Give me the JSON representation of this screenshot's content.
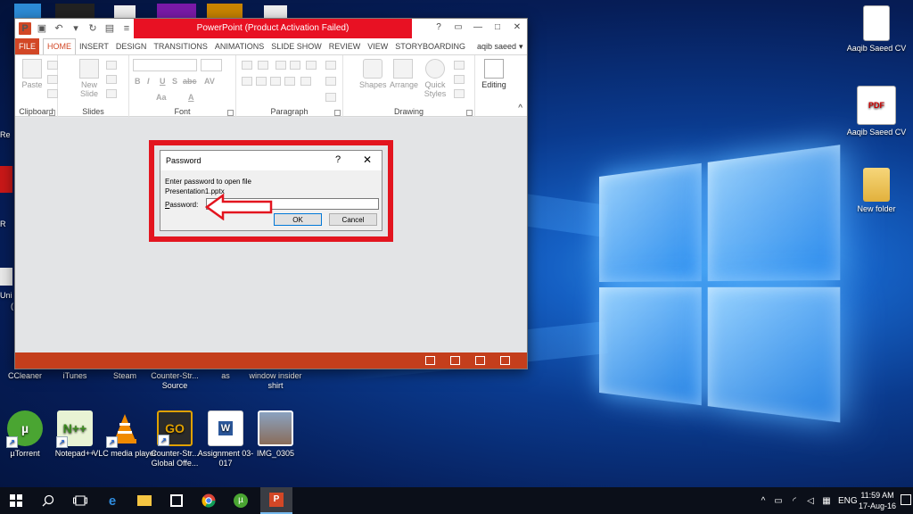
{
  "desktop": {
    "bottom_icons": [
      {
        "label": "µTorrent",
        "icon": "utorrent-icon",
        "color": "#4aa532"
      },
      {
        "label": "Notepad++",
        "icon": "notepadpp-icon",
        "color": "#7cbf3a"
      },
      {
        "label": "VLC media player",
        "icon": "vlc-icon",
        "color": "#f08a00"
      },
      {
        "label": "Counter-Str... Global Offe...",
        "icon": "csgo-icon",
        "color": "#e0a100"
      },
      {
        "label": "Assignment 03-017",
        "icon": "word-doc-icon",
        "color": "#2b579a"
      },
      {
        "label": "IMG_0305",
        "icon": "image-icon",
        "color": "#8a6d5a"
      }
    ],
    "row_labels": [
      "CCleaner",
      "iTunes",
      "Steam",
      "Counter-Str... Source",
      "as",
      "window insider shirt"
    ],
    "right_icons": [
      {
        "label": "Aaqib Saeed CV",
        "icon": "pdf-document-icon"
      },
      {
        "label": "Aaqib Saeed CV",
        "icon": "pdf-document-icon"
      },
      {
        "label": "New folder",
        "icon": "folder-icon"
      }
    ],
    "edge_fragments": [
      "Re",
      "R",
      "Uni",
      "("
    ]
  },
  "powerpoint": {
    "title": "PowerPoint (Product Activation Failed)",
    "tabs": [
      "FILE",
      "HOME",
      "INSERT",
      "DESIGN",
      "TRANSITIONS",
      "ANIMATIONS",
      "SLIDE SHOW",
      "REVIEW",
      "VIEW",
      "STORYBOARDING"
    ],
    "active_tab": "HOME",
    "user_name": "aqib saeed",
    "ribbon": {
      "clipboard": {
        "label": "Clipboard",
        "paste": "Paste"
      },
      "slides": {
        "label": "Slides",
        "new_slide": "New Slide"
      },
      "font": {
        "label": "Font",
        "bold": "B",
        "italic": "I",
        "underline": "U",
        "strike": "S",
        "shadow": "abc",
        "spacing": "AV",
        "case": "Aa",
        "color": "A"
      },
      "paragraph": {
        "label": "Paragraph"
      },
      "drawing": {
        "label": "Drawing",
        "shapes": "Shapes",
        "arrange": "Arrange",
        "quick_styles": "Quick Styles"
      },
      "editing": {
        "label": "Editing"
      }
    }
  },
  "dialog": {
    "title": "Password",
    "help": "?",
    "close": "✕",
    "message_line1": "Enter password to open file",
    "message_line2": "Presentation1.pptx",
    "password_label_underlined": "P",
    "password_label_rest": "assword:",
    "password_value": "",
    "ok": "OK",
    "cancel": "Cancel"
  },
  "taskbar": {
    "language": "ENG",
    "time": "11:59 AM",
    "date": "17-Aug-16"
  },
  "colors": {
    "accent_ppt": "#d24726",
    "title_alert": "#e81123",
    "highlight": "#e3151f"
  }
}
